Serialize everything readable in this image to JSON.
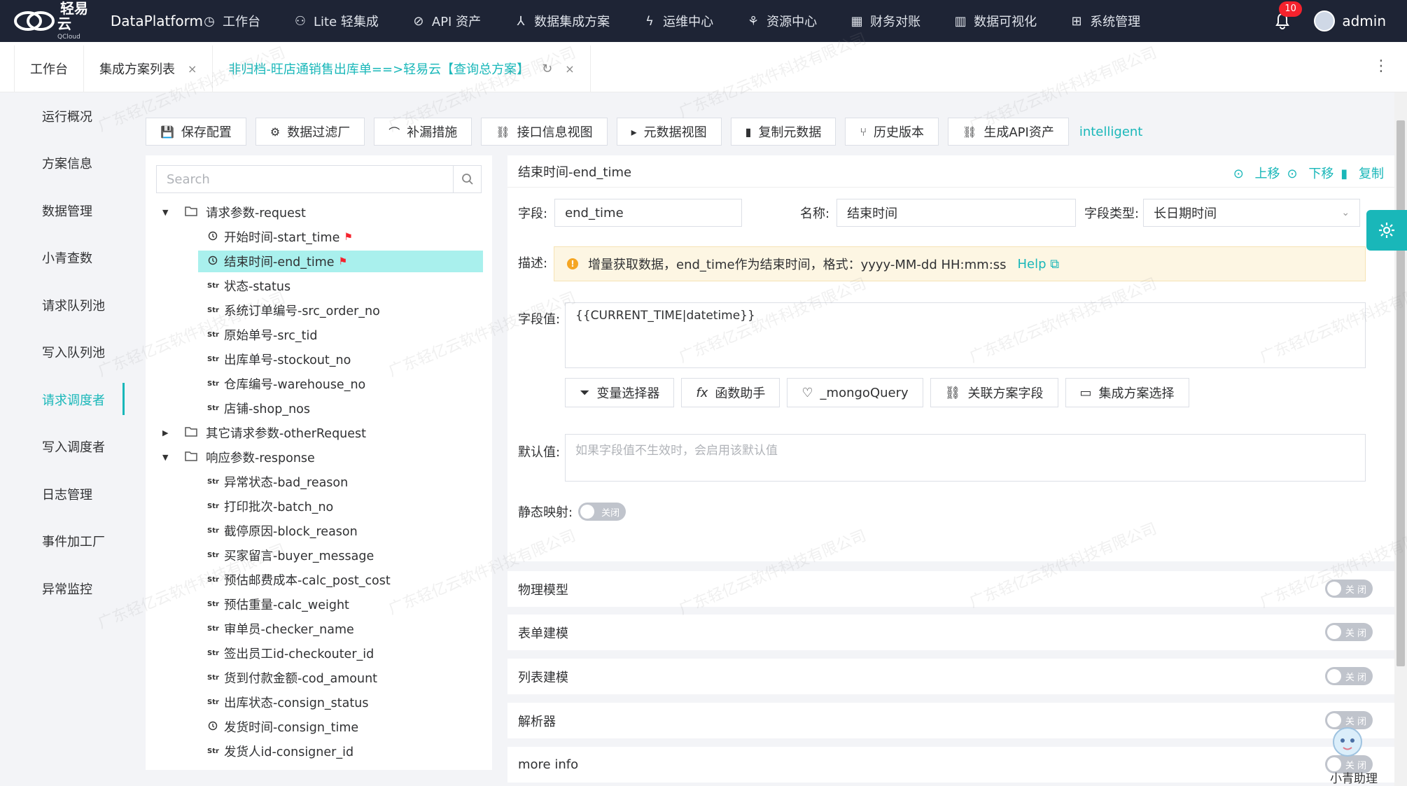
{
  "brand": {
    "name_cn": "轻易云",
    "sub": "QCloud",
    "platform": "DataPlatform"
  },
  "nav": [
    {
      "label": "工作台",
      "icon": "clock-icon"
    },
    {
      "label": "Lite 轻集成",
      "icon": "bug-icon"
    },
    {
      "label": "API 资产",
      "icon": "compass-icon"
    },
    {
      "label": "数据集成方案",
      "icon": "network-icon"
    },
    {
      "label": "运维中心",
      "icon": "bolt-icon"
    },
    {
      "label": "资源中心",
      "icon": "sitemap-icon"
    },
    {
      "label": "财务对账",
      "icon": "calculator-icon"
    },
    {
      "label": "数据可视化",
      "icon": "chart-icon"
    },
    {
      "label": "系统管理",
      "icon": "grid-icon"
    }
  ],
  "user": {
    "notifications": "10",
    "name": "admin"
  },
  "tabs": [
    {
      "label": "工作台"
    },
    {
      "label": "集成方案列表",
      "close": "×"
    },
    {
      "label": "非归档-旺店通销售出库单==>轻易云【查询总方案】",
      "refresh": "↻",
      "close": "×"
    }
  ],
  "tab_more": "⋮",
  "sidebar": [
    "运行概况",
    "方案信息",
    "数据管理",
    "小青查数",
    "请求队列池",
    "写入队列池",
    "请求调度者",
    "写入调度者",
    "日志管理",
    "事件加工厂",
    "异常监控"
  ],
  "toolbar": [
    {
      "label": "保存配置",
      "icon": "save-icon"
    },
    {
      "label": "数据过滤厂",
      "icon": "gear-icon"
    },
    {
      "label": "补漏措施",
      "icon": "chart-line-icon"
    },
    {
      "label": "接口信息视图",
      "icon": "link-icon"
    },
    {
      "label": "元数据视图",
      "icon": "terminal-icon"
    },
    {
      "label": "复制元数据",
      "icon": "copy-icon"
    },
    {
      "label": "历史版本",
      "icon": "branch-icon"
    },
    {
      "label": "生成API资产",
      "icon": "link-icon"
    }
  ],
  "intelligent": "intelligent",
  "search": {
    "placeholder": "Search"
  },
  "tree": [
    {
      "level": 0,
      "caret": "down",
      "label": "请求参数-request"
    },
    {
      "level": 1,
      "type": "time",
      "label": "开始时间-start_time",
      "flag": true
    },
    {
      "level": 1,
      "type": "time",
      "label": "结束时间-end_time",
      "flag": true,
      "selected": true
    },
    {
      "level": 1,
      "type": "str",
      "label": "状态-status"
    },
    {
      "level": 1,
      "type": "str",
      "label": "系统订单编号-src_order_no"
    },
    {
      "level": 1,
      "type": "str",
      "label": "原始单号-src_tid"
    },
    {
      "level": 1,
      "type": "str",
      "label": "出库单号-stockout_no"
    },
    {
      "level": 1,
      "type": "str",
      "label": "仓库编号-warehouse_no"
    },
    {
      "level": 1,
      "type": "str",
      "label": "店铺-shop_nos"
    },
    {
      "level": 0,
      "caret": "right",
      "label": "其它请求参数-otherRequest"
    },
    {
      "level": 0,
      "caret": "down",
      "label": "响应参数-response"
    },
    {
      "level": 1,
      "type": "str",
      "label": "异常状态-bad_reason"
    },
    {
      "level": 1,
      "type": "str",
      "label": "打印批次-batch_no"
    },
    {
      "level": 1,
      "type": "str",
      "label": "截停原因-block_reason"
    },
    {
      "level": 1,
      "type": "str",
      "label": "买家留言-buyer_message"
    },
    {
      "level": 1,
      "type": "str",
      "label": "预估邮费成本-calc_post_cost"
    },
    {
      "level": 1,
      "type": "str",
      "label": "预估重量-calc_weight"
    },
    {
      "level": 1,
      "type": "str",
      "label": "审单员-checker_name"
    },
    {
      "level": 1,
      "type": "str",
      "label": "签出员工id-checkouter_id"
    },
    {
      "level": 1,
      "type": "str",
      "label": "货到付款金额-cod_amount"
    },
    {
      "level": 1,
      "type": "str",
      "label": "出库状态-consign_status"
    },
    {
      "level": 1,
      "type": "time",
      "label": "发货时间-consign_time"
    },
    {
      "level": 1,
      "type": "str",
      "label": "发货人id-consigner_id"
    }
  ],
  "tree_type_labels": {
    "str": "Str"
  },
  "detail": {
    "title": "结束时间-end_time",
    "actions": {
      "up": "上移",
      "down": "下移",
      "copy": "复制"
    },
    "field_label": "字段:",
    "field_value": "end_time",
    "name_label": "名称:",
    "name_value": "结束时间",
    "type_label": "字段类型:",
    "type_value": "长日期时间",
    "desc_label": "描述:",
    "desc_text": "增量获取数据，end_time作为结束时间，格式：yyyy-MM-dd HH:mm:ss",
    "help": "Help",
    "value_label": "字段值:",
    "value": "{{CURRENT_TIME|datetime}}",
    "helpers": [
      {
        "label": "变量选择器",
        "icon": "filter-icon"
      },
      {
        "label": "函数助手",
        "icon": "fx-icon"
      },
      {
        "label": "_mongoQuery",
        "icon": "bulb-icon"
      },
      {
        "label": "关联方案字段",
        "icon": "link-icon"
      },
      {
        "label": "集成方案选择",
        "icon": "cluster-icon"
      }
    ],
    "default_label": "默认值:",
    "default_placeholder": "如果字段值不生效时，会启用该默认值",
    "static_label": "静态映射:",
    "switch_off": "关闭"
  },
  "sections": [
    {
      "label": "物理模型",
      "switch": "关 闭"
    },
    {
      "label": "表单建模",
      "switch": "关 闭"
    },
    {
      "label": "列表建模",
      "switch": "关 闭"
    },
    {
      "label": "解析器",
      "switch": "关 闭"
    },
    {
      "label": "more info",
      "switch": "关 闭"
    }
  ],
  "assistant": "小青助理",
  "watermark": "广东轻亿云软件科技有限公司",
  "colors": {
    "accent": "#19b7b9",
    "nav_bg": "#1e2435",
    "selected_bg": "#a9f0ed",
    "flag": "#f5222d"
  }
}
